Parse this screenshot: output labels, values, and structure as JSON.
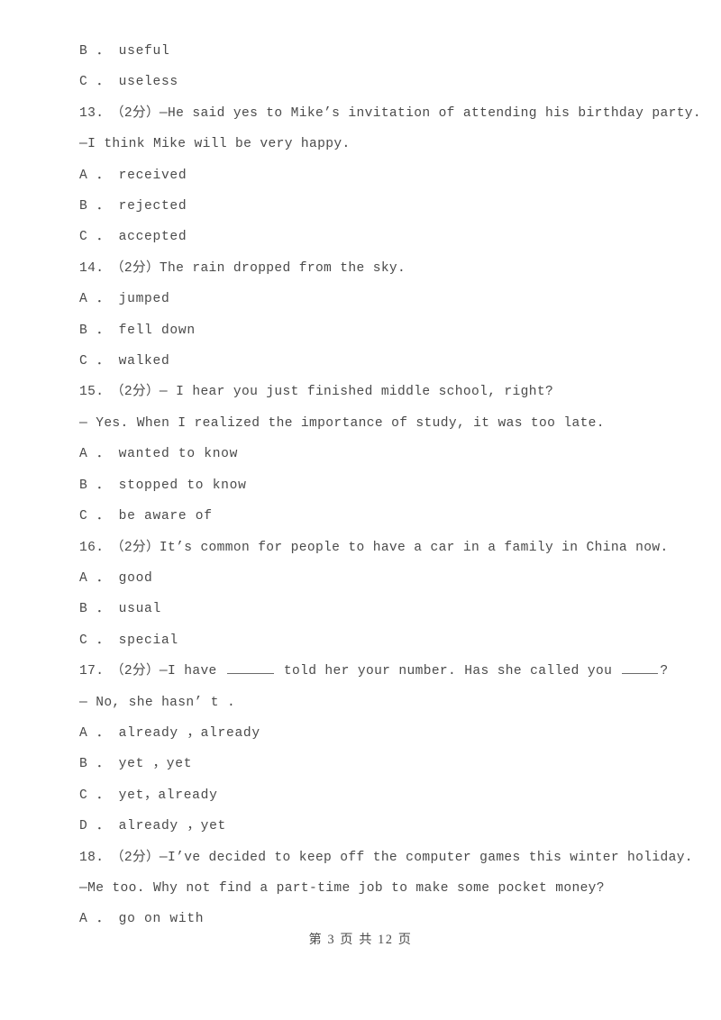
{
  "document": {
    "type": "exam-paper",
    "language": "zh-CN-with-english",
    "text_color": "#4a4a4a",
    "background_color": "#ffffff"
  },
  "body_lines": [
    {
      "kind": "option",
      "text": "B ． useful"
    },
    {
      "kind": "option",
      "text": "C ． useless"
    },
    {
      "kind": "question",
      "text": "13.　（2分）—He said yes to Mike’s invitation of attending his birthday party."
    },
    {
      "kind": "question-cont",
      "text": "—I think Mike will be very happy."
    },
    {
      "kind": "option",
      "text": "A ． received"
    },
    {
      "kind": "option",
      "text": "B ． rejected"
    },
    {
      "kind": "option",
      "text": "C ． accepted"
    },
    {
      "kind": "question",
      "text": "14.　（2分）The rain dropped from the sky."
    },
    {
      "kind": "option",
      "text": "A ． jumped"
    },
    {
      "kind": "option",
      "text": "B ． fell down"
    },
    {
      "kind": "option",
      "text": "C ． walked"
    },
    {
      "kind": "question",
      "text": "15.　（2分）— I hear you just finished middle school, right?"
    },
    {
      "kind": "question-cont",
      "text": "— Yes. When I realized the importance of study, it was too late."
    },
    {
      "kind": "option",
      "text": "A ． wanted to know"
    },
    {
      "kind": "option",
      "text": "B ． stopped to know"
    },
    {
      "kind": "option",
      "text": "C ． be aware of"
    },
    {
      "kind": "question",
      "text": "16.　（2分）It’s common for people to have a car in a family in China now."
    },
    {
      "kind": "option",
      "text": "A ． good"
    },
    {
      "kind": "option",
      "text": "B ． usual"
    },
    {
      "kind": "option",
      "text": "C ． special"
    },
    {
      "kind": "question-blank",
      "prefix": "17.　（2分）—I have ",
      "middle": " told her your number. Has she called you ",
      "suffix": "?"
    },
    {
      "kind": "question-cont",
      "text": "— No, she hasn’ t ."
    },
    {
      "kind": "option",
      "text": "A ． already ，already"
    },
    {
      "kind": "option",
      "text": "B ． yet ，yet"
    },
    {
      "kind": "option",
      "text": "C ． yet，already"
    },
    {
      "kind": "option",
      "text": "D ． already ，yet"
    },
    {
      "kind": "question",
      "text": "18.　（2分）—I’ve decided to keep off the computer games this winter holiday."
    },
    {
      "kind": "question-cont",
      "text": "—Me too. Why not find a part-time job to make some pocket money?"
    },
    {
      "kind": "option",
      "text": "A ． go on with"
    }
  ],
  "footer": {
    "text": "第 3 页 共 12 页",
    "current_page": "3",
    "total_pages": "12"
  }
}
